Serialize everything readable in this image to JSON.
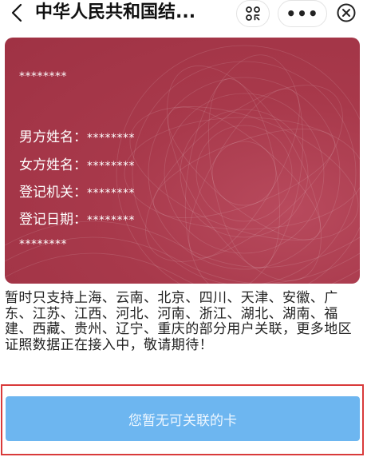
{
  "header": {
    "title": "中华人民共和国结...",
    "more_icon_text": "•••"
  },
  "card": {
    "masked_title": "********",
    "fields": [
      {
        "label": "男方姓名：",
        "value": "********"
      },
      {
        "label": "女方姓名：",
        "value": "********"
      },
      {
        "label": "登记机关：",
        "value": "********"
      },
      {
        "label": "登记日期：",
        "value": "********"
      }
    ],
    "masked_footer": "********",
    "colors": {
      "base": "#a8394b",
      "highlight": "#b84a5d"
    }
  },
  "note": "暂时只支持上海、云南、北京、四川、天津、安徽、广东、江苏、江西、河北、河南、浙江、湖北、湖南、福建、西藏、贵州、辽宁、重庆的部分用户关联，更多地区证照数据正在接入中，敬请期待！",
  "bottom": {
    "button_label": "您暂无可关联的卡",
    "button_color": "#6db6f0",
    "highlight_border_color": "#d93a3a"
  }
}
